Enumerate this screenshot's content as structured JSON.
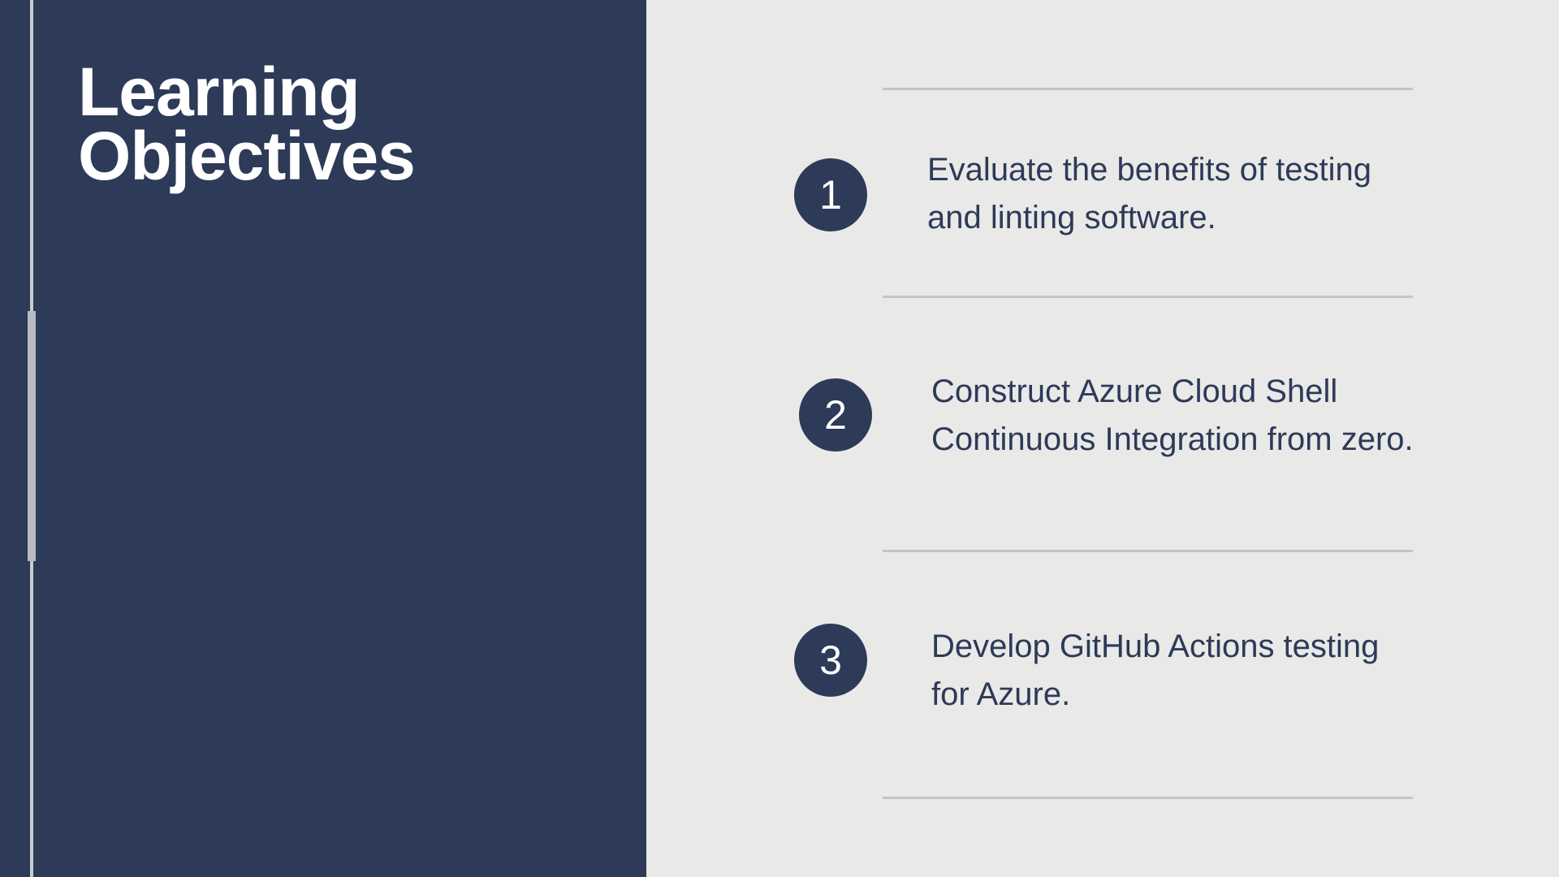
{
  "slide": {
    "title_line1": "Learning",
    "title_line2": "Objectives"
  },
  "objectives": [
    {
      "number": "1",
      "line1": "Evaluate the benefits of testing",
      "line2": "and linting software."
    },
    {
      "number": "2",
      "line1": "Construct Azure Cloud Shell",
      "line2": "Continuous Integration from zero."
    },
    {
      "number": "3",
      "line1": "Develop GitHub Actions testing",
      "line2": "for Azure."
    }
  ],
  "colors": {
    "panel": "#2d3a58",
    "background": "#e9e9e8",
    "divider": "#c4c4c4",
    "text": "#2d3a58"
  }
}
